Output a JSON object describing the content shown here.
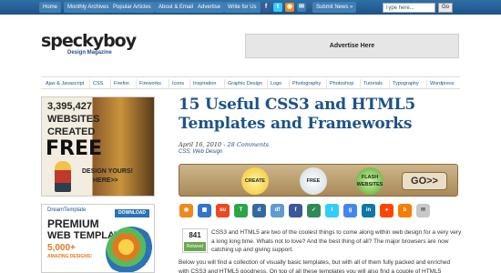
{
  "topnav": {
    "home": "Home",
    "archives": "Monthly Archives",
    "popular": "Popular Articles",
    "about": "About & Email",
    "advertise": "Advertise",
    "write": "Write for Us",
    "submit": "Submit News »"
  },
  "search": {
    "placeholder": "Type here...",
    "button": "Go"
  },
  "logo": {
    "name": "speckyboy",
    "tagline": "Design Magazine"
  },
  "ad_box": {
    "label": "Advertise Here"
  },
  "categories": [
    "Ajax & Javascript",
    "CSS",
    "Firefox",
    "Fireworks",
    "Icons",
    "Inspiration",
    "Graphic Design",
    "Logo",
    "Photography",
    "Photoshop",
    "Tutorials",
    "Typography",
    "Wordpress"
  ],
  "sidebar_ad1": {
    "number": "3,395,427",
    "line1": "WEBSITES",
    "line2": "CREATED",
    "line3": "FREE",
    "cta1": "DESIGN YOURS!",
    "cta2": "HERE>>"
  },
  "sidebar_ad2": {
    "brand": "DreamTemplate",
    "download": "DOWNLOAD",
    "line1": "PREMIUM",
    "line2": "WEB TEMPLATES",
    "count": "5,000+",
    "sub": "AMAZING DESIGNS!"
  },
  "article": {
    "title": "15 Useful CSS3 and HTML5 Templates and Frameworks",
    "date": "April 16, 2010 -",
    "comments": "28 Comments",
    "categories": "CSS, Web Design",
    "retweet_count": "841",
    "retweet_label": "Retweet",
    "paragraph1": "CSS3 and HTML5 are two of the coolest things to come along within web design for a very very a long long time. Whats not to love? And the best thing of all? The major browsers are now catching up and giving support.",
    "paragraph2": "Below you will find a collection of visually basic templates, but with all of them fully packed and enriched with CSS3 and HTML5 goodness. On top of all these templates you will also find a couple of HTML5 powered CSS3"
  },
  "banner": {
    "create": "CREATE",
    "free": "FREE",
    "flash": "FLASH WEBSITES",
    "go": "GO>>"
  },
  "share_icons": [
    "rss-icon",
    "delicious-icon",
    "stumbleupon-icon",
    "technorati-icon",
    "digg-icon",
    "designfloat-icon",
    "facebook-icon",
    "newsvine-icon",
    "twitter-icon",
    "google-icon",
    "linkedin-icon",
    "reddit-icon",
    "blogger-icon",
    "email-icon"
  ]
}
